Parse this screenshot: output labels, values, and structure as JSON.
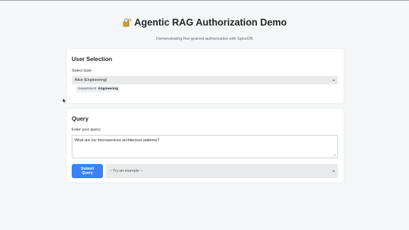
{
  "header": {
    "title": "Agentic RAG Authorization Demo",
    "subtitle": "Demonstrating fine-grained authorization with SpiceDB",
    "icon": "lock-key-icon"
  },
  "user_selection": {
    "title": "User Selection",
    "select_label": "Select User:",
    "selected_user": "Alice (Engineering)",
    "department_label": "Department:",
    "department_value": "Engineering"
  },
  "query": {
    "title": "Query",
    "input_label": "Enter your query:",
    "input_value": "What are our microservices architecture patterns?",
    "submit_label": "Submit Query",
    "example_placeholder": "-- Try an example --"
  },
  "colors": {
    "accent": "#3b82f6",
    "background": "#f5f6f8"
  }
}
